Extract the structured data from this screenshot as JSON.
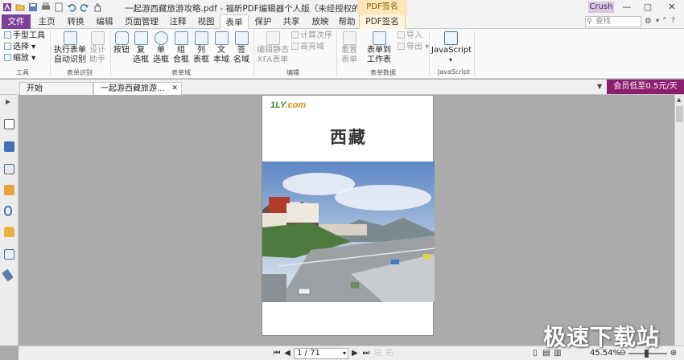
{
  "titlebar": {
    "title": "一起游西藏旅游攻略.pdf - 福昕PDF编辑器个人版（未经授权的产品）",
    "user_button": "Crush",
    "minimize_glyph": "—",
    "restore_glyph": "▢",
    "close_glyph": "✕"
  },
  "qat": {
    "icons": [
      "app-icon",
      "open-icon",
      "save-icon",
      "print-icon",
      "print-preview-icon",
      "undo-icon",
      "redo-icon",
      "hand-icon"
    ]
  },
  "ribbon_tabs": [
    "文件",
    "主页",
    "转换",
    "编辑",
    "页面管理",
    "注释",
    "视图",
    "表单",
    "保护",
    "共享",
    "放映",
    "帮助",
    "PDF签名"
  ],
  "context_tab_label": "PDF签名",
  "search": {
    "placeholder": "查找"
  },
  "ribbon": {
    "tools_group": {
      "hand": "手型工具",
      "select": "选择",
      "zoom": "缩放",
      "label": "工具"
    },
    "recognize_group": {
      "run": "执行表单\n自动识别",
      "design": "设计\n助手",
      "label": "表单识别"
    },
    "fields_group": {
      "button": "按钮",
      "checkbox": "复\n选框",
      "radio": "单\n选框",
      "combo": "组\n合框",
      "list": "列\n表框",
      "text": "文\n本域",
      "sign": "签\n名域",
      "label": "表单域"
    },
    "edit_group": {
      "edit_static": "编辑静态\nXFA表单",
      "calc_order": "计算次序",
      "highlight": "高亮域",
      "label": "编辑"
    },
    "data_group": {
      "reset": "重置\n表单",
      "to_sheet": "表单到\n工作表",
      "import": "导入",
      "export": "导出",
      "label": "表单数据"
    },
    "js_group": {
      "js": "JavaScript",
      "label": "JavaScript"
    }
  },
  "doc_tabs": [
    {
      "label": "开始"
    },
    {
      "label": "一起游西藏旅游..."
    }
  ],
  "vip_banner": "会员低至0.5元/天",
  "page": {
    "logo_main": "1LY",
    "logo_sub": ".com",
    "title": "西藏"
  },
  "nav": {
    "page_value": "1 / 71",
    "zoom": "45.54%"
  },
  "watermark": "极速下载站"
}
